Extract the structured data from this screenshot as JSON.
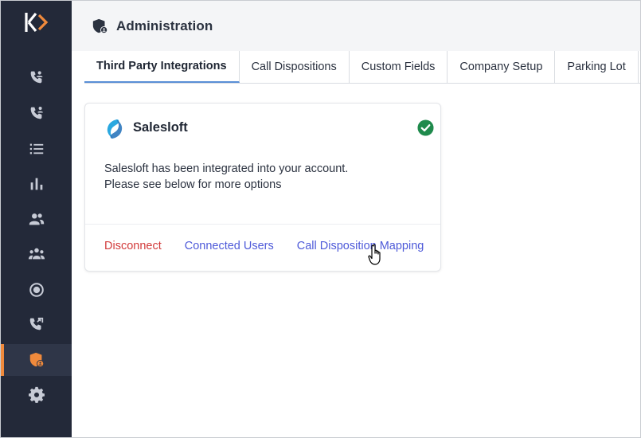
{
  "header": {
    "title": "Administration"
  },
  "sidebar": {
    "logo_letter": "K",
    "items": [
      {
        "icon": "phone-contacts-icon",
        "active": false
      },
      {
        "icon": "phone-user-icon",
        "active": false
      },
      {
        "icon": "list-icon",
        "active": false
      },
      {
        "icon": "bar-chart-icon",
        "active": false
      },
      {
        "icon": "users-icon",
        "active": false
      },
      {
        "icon": "team-icon",
        "active": false
      },
      {
        "icon": "record-icon",
        "active": false
      },
      {
        "icon": "call-forward-icon",
        "active": false
      },
      {
        "icon": "admin-shield-icon",
        "active": true
      },
      {
        "icon": "gear-icon",
        "active": false
      }
    ]
  },
  "tabs": [
    {
      "label": "Third Party Integrations",
      "active": true
    },
    {
      "label": "Call Dispositions",
      "active": false
    },
    {
      "label": "Custom Fields",
      "active": false
    },
    {
      "label": "Company Setup",
      "active": false
    },
    {
      "label": "Parking Lot",
      "active": false
    }
  ],
  "integration": {
    "name": "Salesloft",
    "status": "connected",
    "description_line1": "Salesloft has been integrated into your account.",
    "description_line2": "Please see below for more options",
    "actions": {
      "disconnect": "Disconnect",
      "connected_users": "Connected Users",
      "call_disposition_mapping": "Call Disposition Mapping"
    }
  },
  "colors": {
    "sidebar_bg": "#232939",
    "accent_orange": "#f08a3c",
    "link_blue": "#4e5ad9",
    "danger_red": "#d23b3b",
    "success_green": "#1f8a4c"
  }
}
